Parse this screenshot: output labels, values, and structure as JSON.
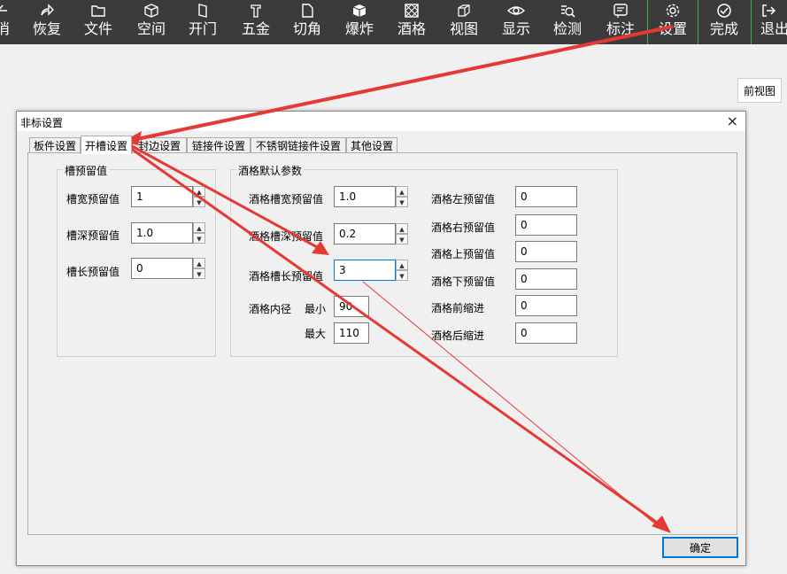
{
  "toolbar": {
    "items": [
      {
        "label": "消",
        "icon": "undo-icon"
      },
      {
        "label": "恢复",
        "icon": "redo-icon"
      },
      {
        "label": "文件",
        "icon": "folder-icon"
      },
      {
        "label": "空间",
        "icon": "cube-icon"
      },
      {
        "label": "开门",
        "icon": "door-icon"
      },
      {
        "label": "五金",
        "icon": "hardware-icon"
      },
      {
        "label": "切角",
        "icon": "cut-corner-icon"
      },
      {
        "label": "爆炸",
        "icon": "explode-icon"
      },
      {
        "label": "酒格",
        "icon": "wine-grid-icon"
      },
      {
        "label": "视图",
        "icon": "view-cube-icon"
      },
      {
        "label": "显示",
        "icon": "eye-icon"
      },
      {
        "label": "检测",
        "icon": "inspect-icon"
      },
      {
        "label": "标注",
        "icon": "annotate-icon"
      },
      {
        "label": "设置",
        "icon": "gear-icon"
      },
      {
        "label": "完成",
        "icon": "check-circle-icon"
      },
      {
        "label": "退出",
        "icon": "exit-icon"
      }
    ],
    "accent_color": "#3cb043"
  },
  "view_tab": {
    "label": "前视图"
  },
  "dialog": {
    "title": "非标设置",
    "close": "×",
    "tabs": [
      "板件设置",
      "开槽设置",
      "封边设置",
      "链接件设置",
      "不锈钢链接件设置",
      "其他设置"
    ],
    "active_tab": "开槽设置",
    "slot_group": {
      "title": "槽预留值",
      "rows": [
        {
          "label": "槽宽预留值",
          "value": "1"
        },
        {
          "label": "槽深预留值",
          "value": "1.0"
        },
        {
          "label": "槽长预留值",
          "value": "0"
        }
      ]
    },
    "wine_group": {
      "title": "酒格默认参数",
      "left_rows": [
        {
          "label": "酒格槽宽预留值",
          "value": "1.0"
        },
        {
          "label": "酒格槽深预留值",
          "value": "0.2"
        },
        {
          "label": "酒格槽长预留值",
          "value": "3"
        }
      ],
      "inner_label": "酒格内径",
      "min_label": "最小",
      "min_value": "90",
      "max_label": "最大",
      "max_value": "110",
      "right_rows": [
        {
          "label": "酒格左预留值",
          "value": "0"
        },
        {
          "label": "酒格右预留值",
          "value": "0"
        },
        {
          "label": "酒格上预留值",
          "value": "0"
        },
        {
          "label": "酒格下预留值",
          "value": "0"
        },
        {
          "label": "酒格前缩进",
          "value": "0"
        },
        {
          "label": "酒格后缩进",
          "value": "0"
        }
      ]
    },
    "ok_button": "确定"
  },
  "annotation_color": "#e53935"
}
